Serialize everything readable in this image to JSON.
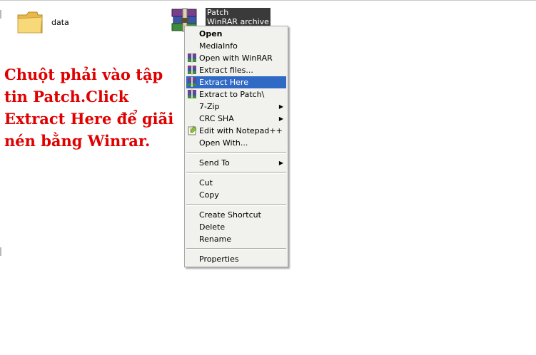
{
  "files": {
    "folder": {
      "label": "data",
      "icon": "folder-icon"
    },
    "archive": {
      "name": "Patch",
      "type": "WinRAR archive",
      "icon": "winrar-archive-icon"
    }
  },
  "instruction_text": "Chuột phải vào tập tin Patch.Click Extract Here để giãi nén bằng Winrar.",
  "context_menu": {
    "items": {
      "open": "Open",
      "mediainfo": "MediaInfo",
      "open_with_winrar": "Open with WinRAR",
      "extract_files": "Extract files...",
      "extract_here": "Extract Here",
      "extract_to_patch": "Extract to Patch\\",
      "seven_zip": "7-Zip",
      "crc_sha": "CRC SHA",
      "edit_notepadpp": "Edit with Notepad++",
      "open_with": "Open With...",
      "send_to": "Send To",
      "cut": "Cut",
      "copy": "Copy",
      "create_shortcut": "Create Shortcut",
      "delete": "Delete",
      "rename": "Rename",
      "properties": "Properties"
    },
    "highlighted_item": "Extract Here"
  },
  "colors": {
    "instruction": "#e00000",
    "highlight": "#316ac5",
    "menu_background": "#f1f1ed",
    "selected_label": "#3a3a3a"
  }
}
